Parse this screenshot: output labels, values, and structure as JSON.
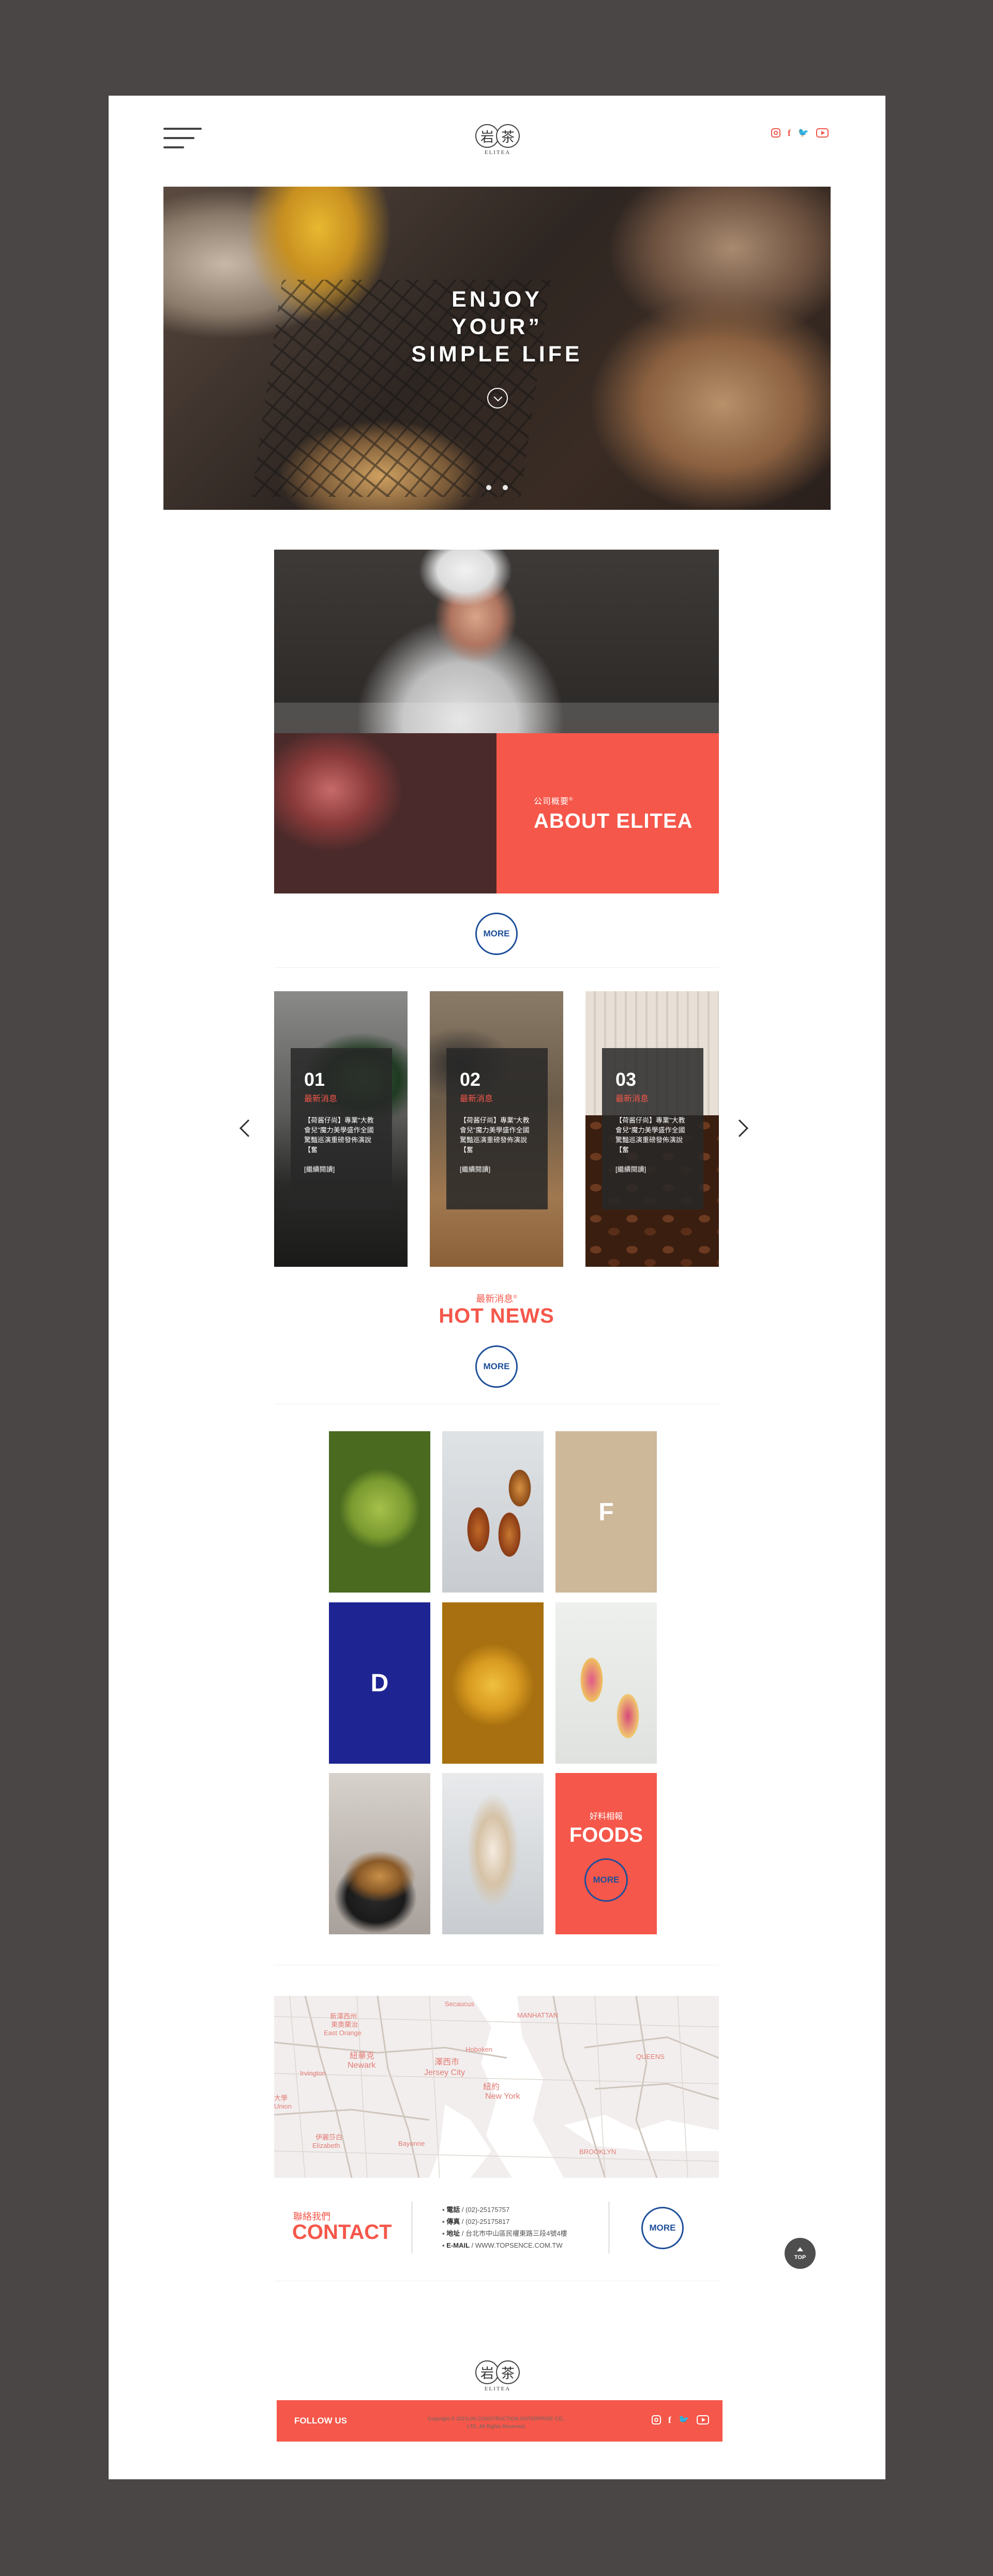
{
  "header": {
    "logo_char_1": "岩",
    "logo_char_2": "茶",
    "brand": "ELITEA",
    "social": [
      {
        "icon": "instagram-icon"
      },
      {
        "icon": "facebook-icon",
        "glyph": "f"
      },
      {
        "icon": "twitter-icon",
        "glyph": "🐦"
      },
      {
        "icon": "youtube-icon"
      }
    ]
  },
  "hero": {
    "title_line1": "ENJOY",
    "title_line2": "YOUR”",
    "title_line3": "SIMPLE LIFE"
  },
  "about": {
    "subtitle": "公司概要",
    "title": "ABOUT ELITEA",
    "more": "MORE"
  },
  "news": {
    "cards": [
      {
        "num": "01",
        "category": "最新消息",
        "text": "【荷酱仔尚】專業\"大教會兒\"魔力美學盛作全國驚豔巡演重磅發佈演說【奮",
        "read": "[繼續閱讀]"
      },
      {
        "num": "02",
        "category": "最新消息",
        "text": "【荷酱仔尚】專業\"大教會兒\"魔力美學盛作全國驚豔巡演重磅發佈演說【奮",
        "read": "[繼續閱讀]"
      },
      {
        "num": "03",
        "category": "最新消息",
        "text": "【荷酱仔尚】專業\"大教會兒\"魔力美學盛作全國驚豔巡演重磅發佈演說【奮",
        "read": "[繼續閱讀]"
      }
    ],
    "subtitle": "最新消息",
    "title": "HOT NEWS",
    "more": "MORE"
  },
  "foods": {
    "letter_f": "F",
    "letter_d": "D",
    "subtitle": "好料相報",
    "title": "FOODS",
    "more": "MORE"
  },
  "map": {
    "labels": [
      "新澤西州",
      "東奧蘭治",
      "East Orange",
      "紐華克",
      "Newark",
      "Irvington",
      "大學",
      "Union",
      "伊麗莎白",
      "Elizabeth",
      "澤西市",
      "Jersey City",
      "Bayonne",
      "紐約",
      "New York",
      "MANHATTAN",
      "BROOKLYN",
      "QUEENS",
      "Secaucus",
      "Hoboken"
    ]
  },
  "contact": {
    "subtitle": "聯絡我們",
    "title": "CONTACT",
    "phone_label": "電話",
    "phone": "(02)-25175757",
    "fax_label": "傳真",
    "fax": "(02)-25175817",
    "address_label": "地址",
    "address": "台北市中山區民權東路三段4號4樓",
    "email_label": "E-MAIL",
    "email": "WWW.TOPSENCE.COM.TW",
    "more": "MORE"
  },
  "to_top": "TOP",
  "follow": {
    "label": "FOLLOW US"
  },
  "footer": {
    "logo_char_1": "岩",
    "logo_char_2": "茶",
    "brand": "ELITEA",
    "copyright_line1": "Copyright © 2021LIN CONSTRUCTION ENTERPRISE CO.,",
    "copyright_line2": "LTD. All Rights Reserved."
  },
  "colors": {
    "accent": "#f5574a",
    "link_blue": "#1e4f9a",
    "navy": "#1e2592",
    "sand": "#cdb89a",
    "outer_bg": "#4a4646"
  }
}
